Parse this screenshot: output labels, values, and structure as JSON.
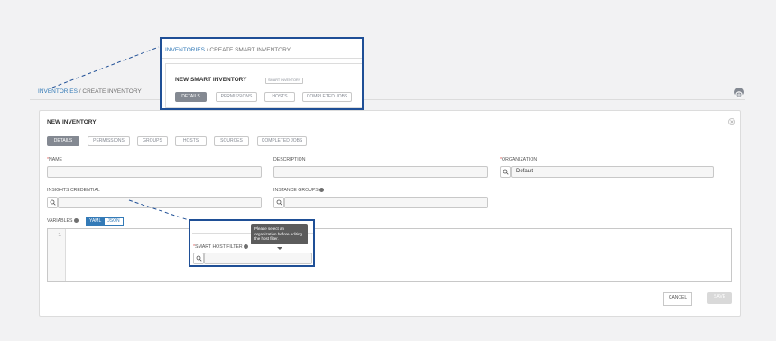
{
  "breadcrumb": {
    "parent": "INVENTORIES",
    "separator": "/",
    "current": "CREATE INVENTORY"
  },
  "panel": {
    "title": "NEW INVENTORY",
    "tabs": [
      {
        "label": "DETAILS",
        "active": true
      },
      {
        "label": "PERMISSIONS",
        "active": false
      },
      {
        "label": "GROUPS",
        "active": false
      },
      {
        "label": "HOSTS",
        "active": false
      },
      {
        "label": "SOURCES",
        "active": false
      },
      {
        "label": "COMPLETED JOBS",
        "active": false
      }
    ],
    "fields": {
      "name_label": "NAME",
      "name_value": "",
      "description_label": "DESCRIPTION",
      "description_value": "",
      "organization_label": "ORGANIZATION",
      "organization_value": "Default",
      "insights_label": "INSIGHTS CREDENTIAL",
      "insights_value": "",
      "instance_groups_label": "INSTANCE GROUPS",
      "instance_groups_value": ""
    },
    "required_marker": "*",
    "variables": {
      "label": "VARIABLES",
      "modes": [
        "YAML",
        "JSON"
      ],
      "active_mode": "YAML",
      "line_number": "1",
      "content": "---"
    },
    "buttons": {
      "cancel": "CANCEL",
      "save": "SAVE"
    }
  },
  "callout_top": {
    "breadcrumb_parent": "INVENTORIES",
    "separator": "/",
    "breadcrumb_current": "CREATE SMART INVENTORY",
    "title": "NEW SMART INVENTORY",
    "tag": "SMART INVENTORY",
    "tabs": [
      {
        "label": "DETAILS",
        "active": true
      },
      {
        "label": "PERMISSIONS",
        "active": false
      },
      {
        "label": "HOSTS",
        "active": false
      },
      {
        "label": "COMPLETED JOBS",
        "active": false
      }
    ]
  },
  "callout_bottom": {
    "tooltip": "Please select an organization before editing the host filter.",
    "label": "SMART HOST FILTER",
    "required_marker": "*",
    "value": ""
  },
  "colors": {
    "accent": "#337ab7",
    "callout_border": "#1f4f96",
    "active_tab": "#848992",
    "required": "#d9534f"
  }
}
